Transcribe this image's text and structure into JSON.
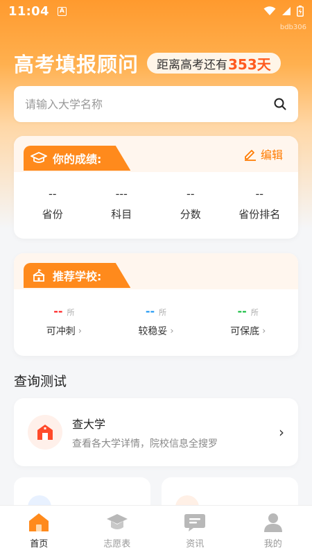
{
  "status": {
    "time": "11:04",
    "a_glyph": "A"
  },
  "watermark": "bdb306",
  "header": {
    "title": "高考填报顾问",
    "countdown_prefix": "距离高考还有",
    "countdown_value": "353天"
  },
  "search": {
    "placeholder": "请输入大学名称"
  },
  "scores": {
    "title": "你的成绩:",
    "edit_label": "编辑",
    "items": [
      {
        "value": "--",
        "label": "省份"
      },
      {
        "value": "---",
        "label": "科目"
      },
      {
        "value": "--",
        "label": "分数"
      },
      {
        "value": "--",
        "label": "省份排名"
      }
    ]
  },
  "recommend": {
    "title": "推荐学校:",
    "unit": "所",
    "items": [
      {
        "value": "--",
        "label": "可冲刺",
        "color": "#ff2a2a"
      },
      {
        "value": "--",
        "label": "较稳妥",
        "color": "#2a9df4"
      },
      {
        "value": "--",
        "label": "可保底",
        "color": "#22c14a"
      }
    ]
  },
  "query_section": {
    "title": "查询测试",
    "feature": {
      "title": "查大学",
      "desc": "查看各大学详情，院校信息全搜罗"
    }
  },
  "colors": {
    "accent": "#ff8a1c",
    "countdown_number": "#ff5a1f"
  },
  "tabbar": [
    {
      "label": "首页",
      "icon": "home-icon",
      "active": true
    },
    {
      "label": "志愿表",
      "icon": "graduation-cap-icon",
      "active": false
    },
    {
      "label": "资讯",
      "icon": "message-icon",
      "active": false
    },
    {
      "label": "我的",
      "icon": "user-icon",
      "active": false
    }
  ]
}
